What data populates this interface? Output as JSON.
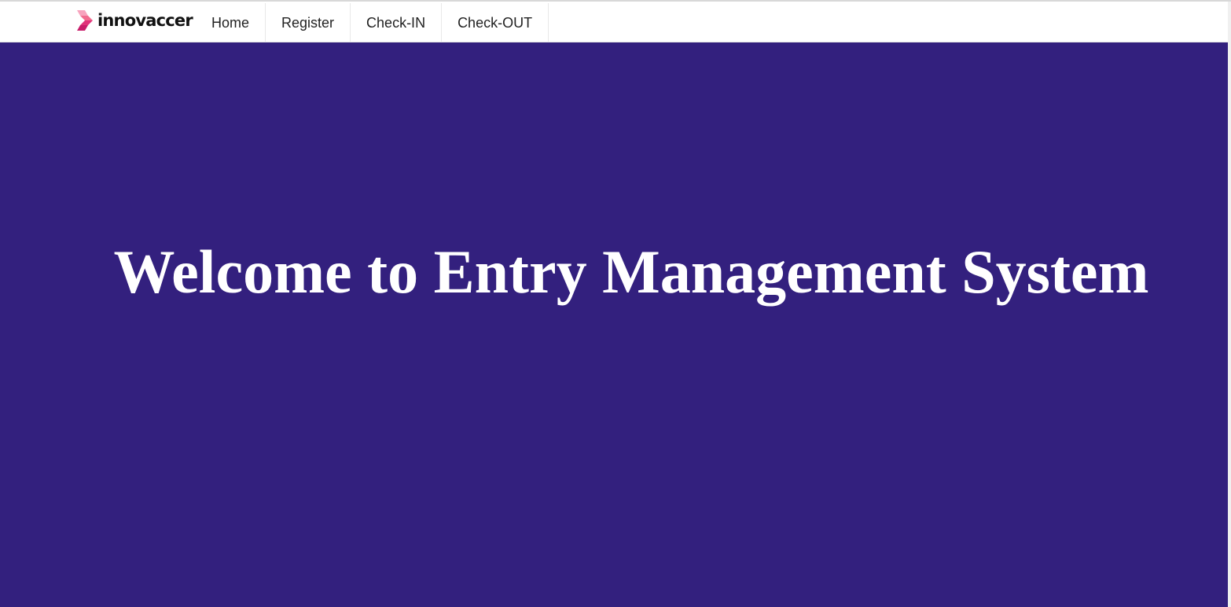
{
  "brand": {
    "name": "innovaccer",
    "logo_icon": "innovaccer-logo-icon",
    "accent_colors": [
      "#f26b8f",
      "#e0337a",
      "#c81d6a"
    ]
  },
  "nav": {
    "items": [
      {
        "label": "Home"
      },
      {
        "label": "Register"
      },
      {
        "label": "Check-IN"
      },
      {
        "label": "Check-OUT"
      }
    ]
  },
  "hero": {
    "title": "Welcome to Entry Management System",
    "background_color": "#33207e",
    "text_color": "#ffffff"
  }
}
